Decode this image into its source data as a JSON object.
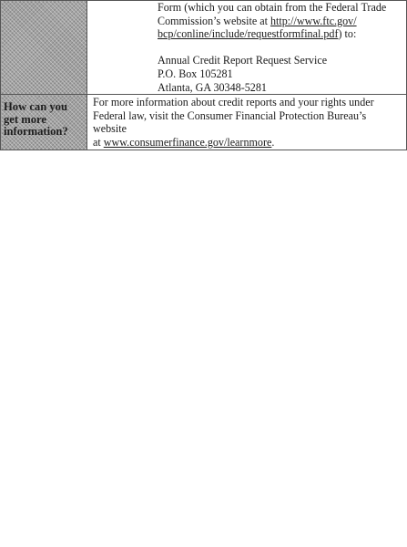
{
  "section_1": {
    "line_1": "Form (which you can obtain from the Federal Trade",
    "line_2_prefix": "Commission’s website at ",
    "line_2_link": "http://www.ftc.gov/",
    "line_3_link": "bcp/conline/include/requestformfinal.pdf",
    "line_3_suffix": ") to:",
    "address": [
      "Annual Credit Report Request Service",
      "P.O. Box 105281",
      "Atlanta, GA 30348-5281"
    ]
  },
  "section_2": {
    "label_lines": [
      "How can you",
      "get more",
      "information?"
    ],
    "text_line_1": "For more information about credit reports and your rights under",
    "text_line_2": "Federal law, visit the Consumer Financial Protection Bureau’s website",
    "text_line_3_prefix": "at ",
    "text_link": "www.consumerfinance.gov/learnmore",
    "text_line_3_suffix": "."
  }
}
